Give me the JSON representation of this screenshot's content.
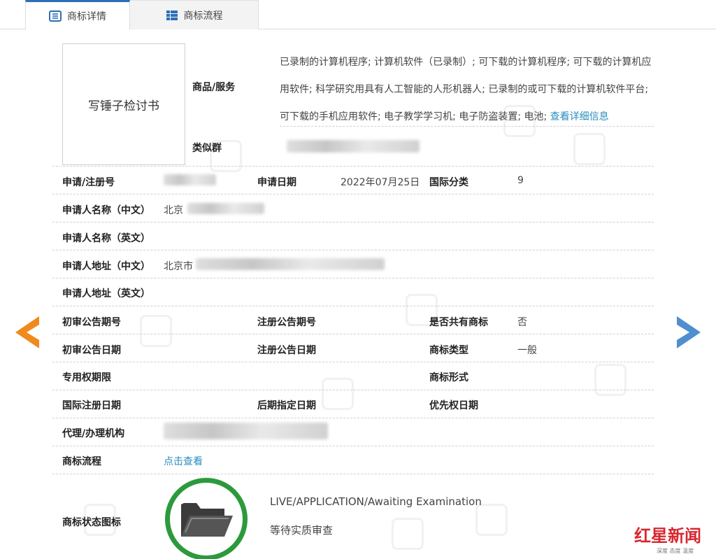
{
  "tabs": [
    {
      "label": "商标详情",
      "icon": "list-detail-icon"
    },
    {
      "label": "商标流程",
      "icon": "grid-flow-icon"
    }
  ],
  "mark": {
    "image_text": "写锤子检讨书"
  },
  "goods": {
    "label": "商品/服务",
    "text": "已录制的计算机程序; 计算机软件（已录制）; 可下载的计算机程序; 可下载的计算机应用软件; 科学研究用具有人工智能的人形机器人; 已录制的或可下载的计算机软件平台; 可下载的手机应用软件; 电子教学学习机; 电子防盗装置; 电池; ",
    "link": "查看详细信息"
  },
  "similar_group": {
    "label": "类似群"
  },
  "fields": {
    "reg_no_label": "申请/注册号",
    "app_date_label": "申请日期",
    "app_date_value": "2022年07月25日",
    "intl_class_label": "国际分类",
    "intl_class_value": "9",
    "applicant_cn_label": "申请人名称（中文）",
    "applicant_cn_value": "北京",
    "applicant_en_label": "申请人名称（英文）",
    "address_cn_label": "申请人地址（中文）",
    "address_cn_value": "北京市",
    "address_en_label": "申请人地址（英文）",
    "prelim_no_label": "初审公告期号",
    "reg_pub_no_label": "注册公告期号",
    "shared_label": "是否共有商标",
    "shared_value": "否",
    "prelim_date_label": "初审公告日期",
    "reg_pub_date_label": "注册公告日期",
    "type_label": "商标类型",
    "type_value": "一般",
    "exclusive_label": "专用权期限",
    "form_label": "商标形式",
    "intl_reg_date_label": "国际注册日期",
    "later_designation_label": "后期指定日期",
    "priority_date_label": "优先权日期",
    "agent_label": "代理/办理机构",
    "process_label": "商标流程",
    "process_link": "点击查看",
    "status_icon_label": "商标状态图标",
    "status_en": "LIVE/APPLICATION/Awaiting Examination",
    "status_cn": "等待实质审查"
  },
  "watermark_logo": {
    "main": "红星新闻",
    "sub": "深度 态度 温度"
  },
  "colors": {
    "tab_accent": "#2d6fb7",
    "link": "#2a8cbf",
    "left_arrow": "#f08a1d",
    "right_arrow": "#4f8fcf",
    "status_ring": "#2c9a3c",
    "logo_red": "#d8272f"
  }
}
